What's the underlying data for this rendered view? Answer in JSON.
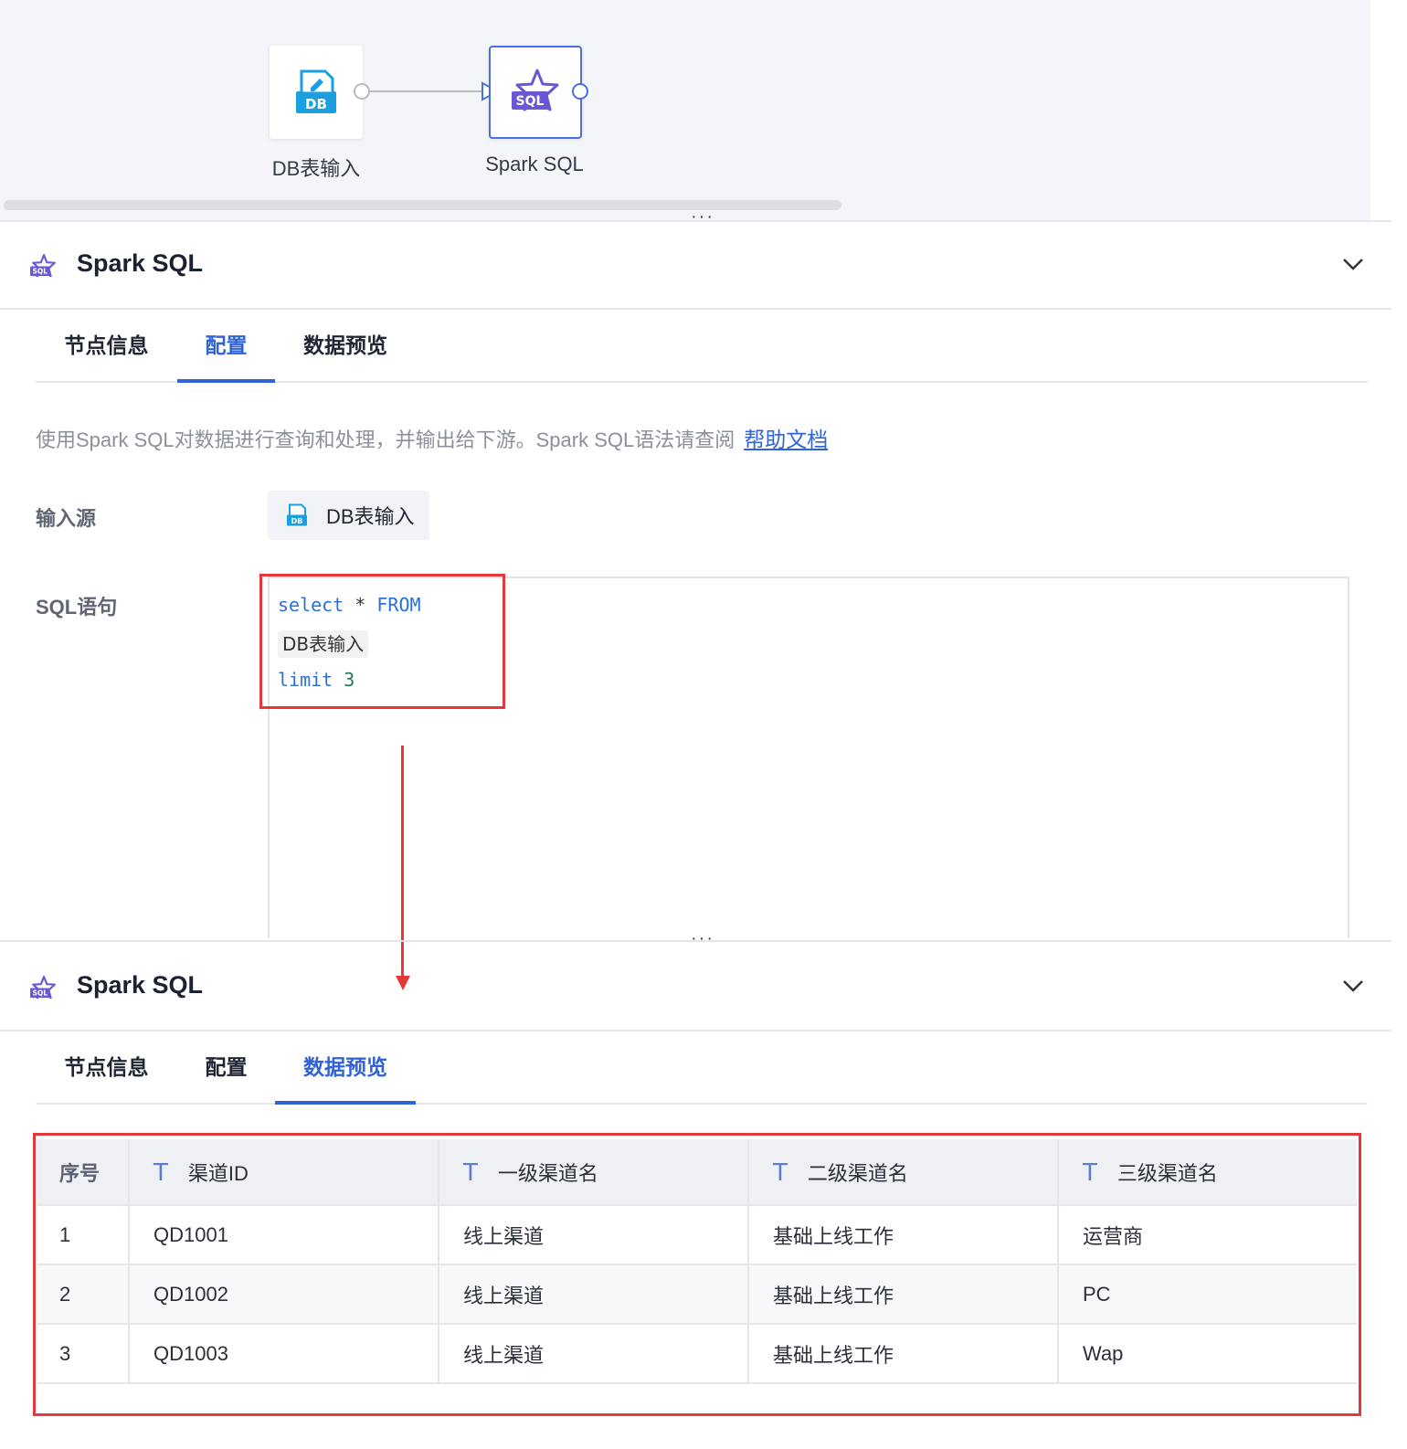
{
  "canvas": {
    "nodes": [
      {
        "label": "DB表输入",
        "icon": "db-icon"
      },
      {
        "label": "Spark SQL",
        "icon": "sql-star-icon"
      }
    ]
  },
  "config_panel": {
    "title": "Spark SQL",
    "tabs": [
      "节点信息",
      "配置",
      "数据预览"
    ],
    "active_tab": "配置",
    "description": "使用Spark SQL对数据进行查询和处理，并输出给下游。Spark SQL语法请查阅",
    "help_link": "帮助文档",
    "input_source_label": "输入源",
    "input_source_value": "DB表输入",
    "sql_label": "SQL语句",
    "sql": {
      "line1_kw1": "select",
      "line1_op": "*",
      "line1_kw2": "FROM",
      "line2_token": "DB表输入",
      "line3_kw": "limit",
      "line3_num": "3"
    }
  },
  "preview_panel": {
    "title": "Spark SQL",
    "tabs": [
      "节点信息",
      "配置",
      "数据预览"
    ],
    "active_tab": "数据预览",
    "table": {
      "columns": [
        "序号",
        "渠道ID",
        "一级渠道名",
        "二级渠道名",
        "三级渠道名"
      ],
      "column_type_icon": "T",
      "rows": [
        [
          "1",
          "QD1001",
          "线上渠道",
          "基础上线工作",
          "运营商"
        ],
        [
          "2",
          "QD1002",
          "线上渠道",
          "基础上线工作",
          "PC"
        ],
        [
          "3",
          "QD1003",
          "线上渠道",
          "基础上线工作",
          "Wap"
        ]
      ]
    }
  },
  "colors": {
    "accent": "#2f63d6",
    "highlight_red": "#e5383b",
    "sql_purple": "#6b56d6",
    "db_blue": "#1aa0e0"
  }
}
